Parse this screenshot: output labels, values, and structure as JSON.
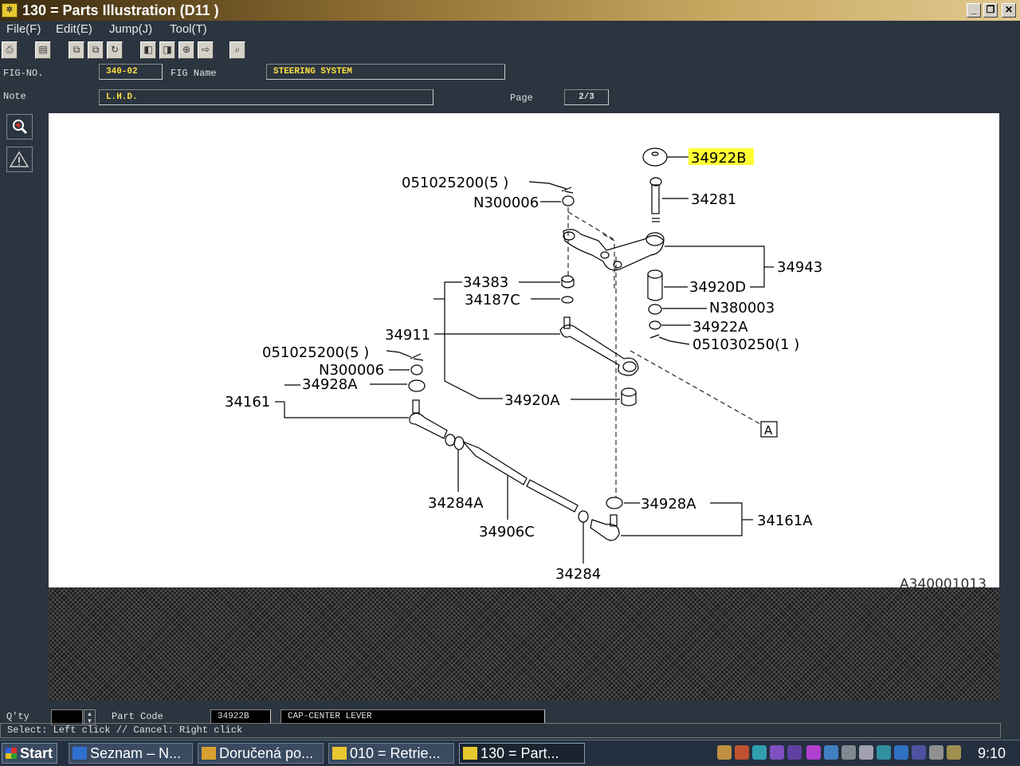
{
  "window": {
    "title": "130 = Parts Illustration (D11   )",
    "minimize": "_",
    "restore": "❐",
    "close": "✕"
  },
  "menu": [
    "File(F)",
    "Edit(E)",
    "Jump(J)",
    "Tool(T)"
  ],
  "header": {
    "fig_no_label": "FIG-NO.",
    "fig_no": "340-02",
    "fig_name_label": "FIG Name",
    "fig_name": "STEERING SYSTEM",
    "note_label": "Note",
    "note": "L.H.D.",
    "page_label": "Page",
    "page": "2/3"
  },
  "diagram": {
    "code": "A340001013",
    "callouts": {
      "c34922B": "34922B",
      "c051025200a": "051025200(5 )",
      "cN300006a": "N300006",
      "c34281": "34281",
      "c34943": "34943",
      "c34383": "34383",
      "c34187C": "34187C",
      "c34920D": "34920D",
      "cN380003": "N380003",
      "c34922A": "34922A",
      "c051030250": "051030250(1 )",
      "c34911": "34911",
      "c051025200b": "051025200(5 )",
      "cN300006b": "N300006",
      "c34928Aa": "34928A",
      "c34161": "34161",
      "c34920A": "34920A",
      "cA": "A",
      "c34284A": "34284A",
      "c34906C": "34906C",
      "c34928Ab": "34928A",
      "c34161A": "34161A",
      "c34284": "34284"
    }
  },
  "footer": {
    "qty_label": "Q'ty",
    "qty": "",
    "part_code_label": "Part Code",
    "part_code": "34922B",
    "part_desc": "CAP-CENTER LEVER",
    "status": "Select: Left click // Cancel: Right click"
  },
  "taskbar": {
    "start": "Start",
    "tasks": [
      "Seznam – N...",
      "Doručená po...",
      "010 = Retrie...",
      "130 = Part..."
    ],
    "clock": "9:10"
  },
  "colors": {
    "highlight": "#ffff33",
    "field_text": "#ffe040"
  }
}
